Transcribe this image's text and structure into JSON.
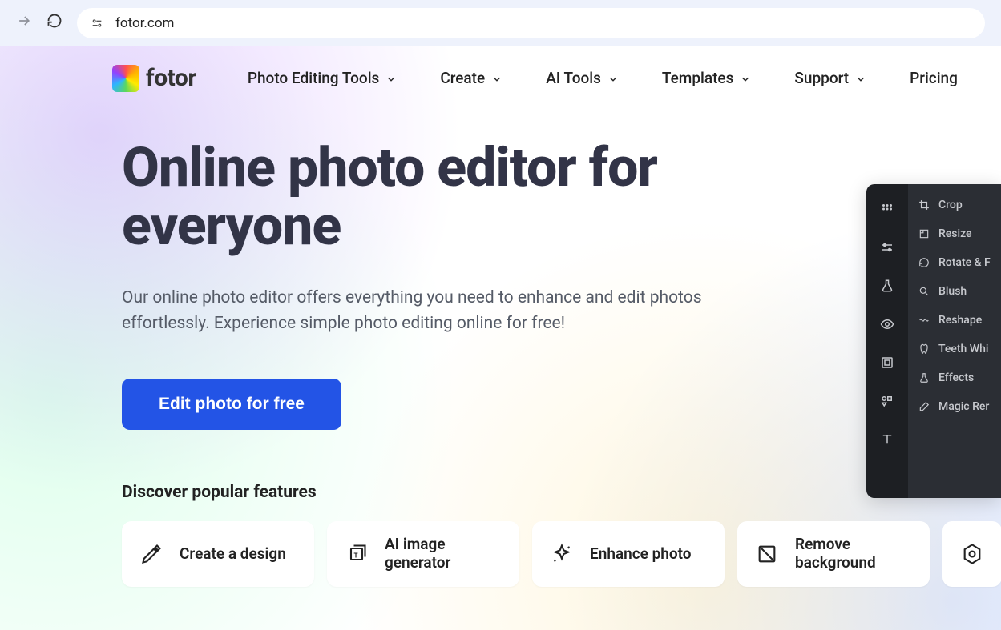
{
  "browser": {
    "url": "fotor.com"
  },
  "header": {
    "logo_text": "fotor",
    "nav": [
      {
        "label": "Photo Editing Tools",
        "has_dropdown": true
      },
      {
        "label": "Create",
        "has_dropdown": true
      },
      {
        "label": "AI Tools",
        "has_dropdown": true
      },
      {
        "label": "Templates",
        "has_dropdown": true
      },
      {
        "label": "Support",
        "has_dropdown": true
      },
      {
        "label": "Pricing",
        "has_dropdown": false
      }
    ]
  },
  "hero": {
    "title": "Online photo editor for everyone",
    "subtitle": "Our online photo editor offers everything you need to enhance and edit photos effortlessly. Experience simple photo editing online for free!",
    "cta": "Edit photo for free"
  },
  "discover": {
    "title": "Discover popular features",
    "features": [
      {
        "label": "Create a design",
        "icon": "pencil-ruler"
      },
      {
        "label": "AI image generator",
        "icon": "layers"
      },
      {
        "label": "Enhance photo",
        "icon": "sparkle-star"
      },
      {
        "label": "Remove background",
        "icon": "crop-remove"
      },
      {
        "label": "",
        "icon": "hexagon"
      }
    ]
  },
  "editor": {
    "sidebar_icons": [
      "grid",
      "sliders",
      "flask",
      "eye",
      "square",
      "shapes",
      "text"
    ],
    "tools": [
      {
        "label": "Crop",
        "icon": "crop"
      },
      {
        "label": "Resize",
        "icon": "resize"
      },
      {
        "label": "Rotate & F",
        "icon": "rotate"
      },
      {
        "label": "Blush",
        "icon": "magnify"
      },
      {
        "label": "Reshape",
        "icon": "wave"
      },
      {
        "label": "Teeth Whi",
        "icon": "tooth"
      },
      {
        "label": "Effects",
        "icon": "flask"
      },
      {
        "label": "Magic Rer",
        "icon": "eraser"
      }
    ]
  }
}
